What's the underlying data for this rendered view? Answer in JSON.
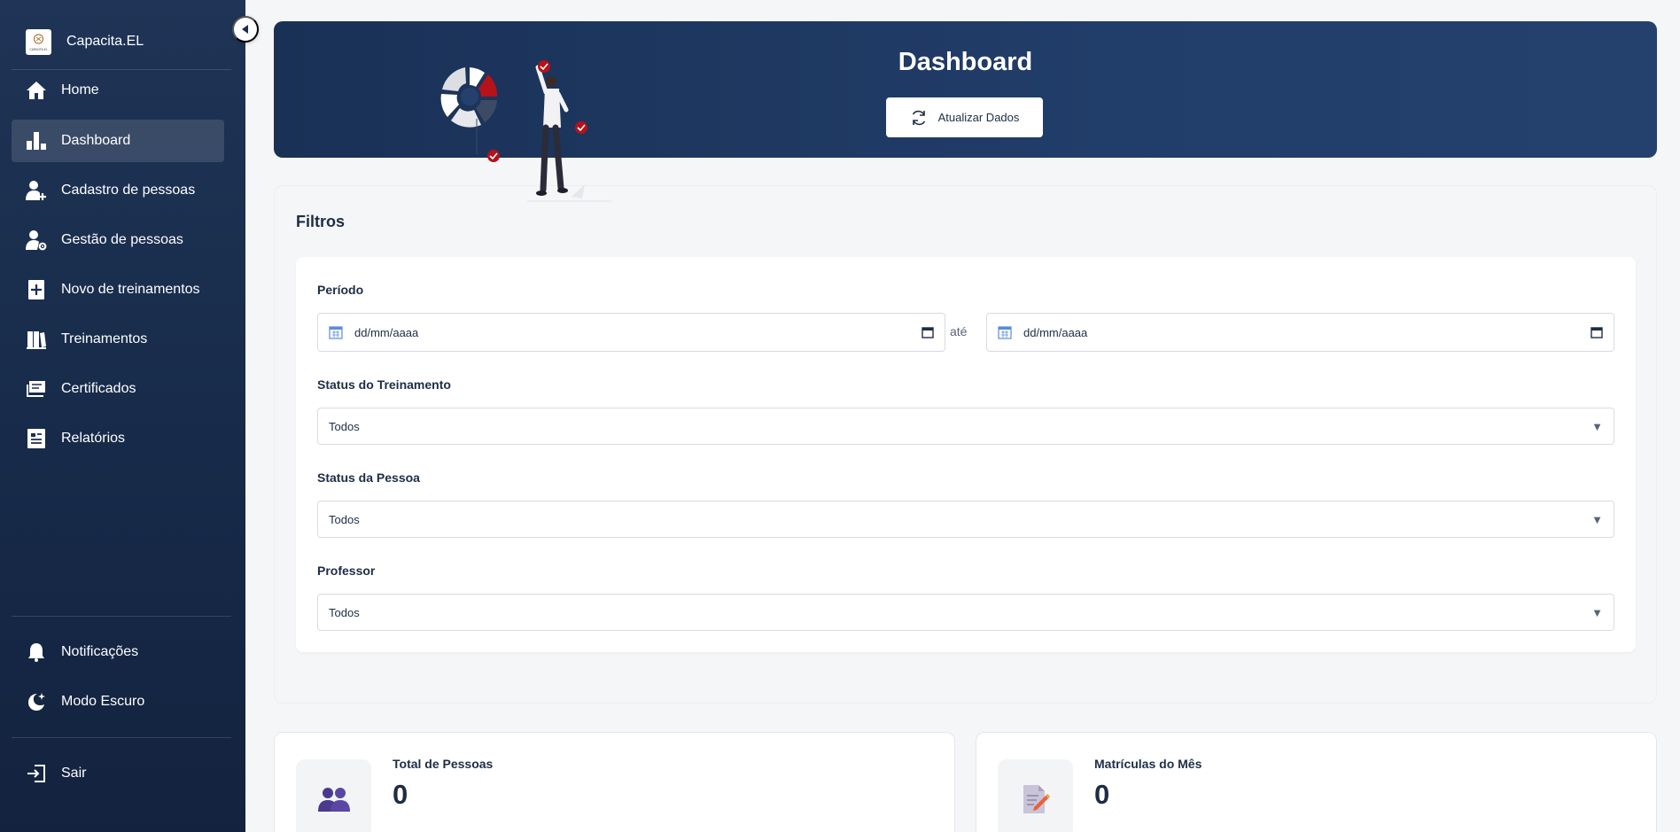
{
  "sidebar": {
    "brand_name": "Capacita.EL",
    "logo_text": "CAPACITA.EL",
    "items": [
      {
        "label": "Home",
        "icon": "home-icon"
      },
      {
        "label": "Dashboard",
        "icon": "bar-chart-icon"
      },
      {
        "label": "Cadastro de pessoas",
        "icon": "user-plus-icon"
      },
      {
        "label": "Gestão de pessoas",
        "icon": "user-gear-icon"
      },
      {
        "label": "Novo de treinamentos",
        "icon": "add-document-icon"
      },
      {
        "label": "Treinamentos",
        "icon": "books-icon"
      },
      {
        "label": "Certificados",
        "icon": "certificate-icon"
      },
      {
        "label": "Relatórios",
        "icon": "report-icon"
      }
    ],
    "bottom_items": [
      {
        "label": "Notificações",
        "icon": "bell-icon"
      },
      {
        "label": "Modo Escuro",
        "icon": "moon-icon"
      }
    ],
    "logout_label": "Sair",
    "active_index": 1
  },
  "header": {
    "title": "Dashboard",
    "refresh_label": "Atualizar Dados"
  },
  "filters": {
    "title": "Filtros",
    "period_label": "Período",
    "date_from_placeholder": "dd/mm/aaaa",
    "date_to_placeholder": "dd/mm/aaaa",
    "range_separator": "até",
    "training_status_label": "Status do Treinamento",
    "training_status_value": "Todos",
    "person_status_label": "Status da Pessoa",
    "person_status_value": "Todos",
    "teacher_label": "Professor",
    "teacher_value": "Todos"
  },
  "stats": [
    {
      "label": "Total de Pessoas",
      "value": "0",
      "icon": "people-icon"
    },
    {
      "label": "Matrículas do Mês",
      "value": "0",
      "icon": "document-pencil-icon"
    }
  ],
  "colors": {
    "sidebar_bg": "#1f3456",
    "banner_bg": "#1a3156",
    "accent_red": "#b5121b",
    "text_dark": "#1e2d45"
  }
}
